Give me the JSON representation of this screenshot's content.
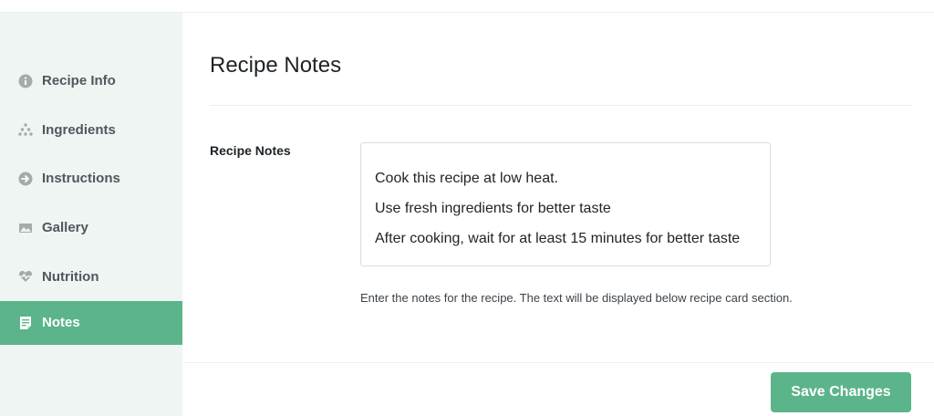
{
  "sidebar": {
    "items": [
      {
        "label": "Recipe Info",
        "icon": "info-icon",
        "active": false
      },
      {
        "label": "Ingredients",
        "icon": "ingredients-icon",
        "active": false
      },
      {
        "label": "Instructions",
        "icon": "arrow-right-circle-icon",
        "active": false
      },
      {
        "label": "Gallery",
        "icon": "gallery-icon",
        "active": false
      },
      {
        "label": "Nutrition",
        "icon": "heart-pulse-icon",
        "active": false
      },
      {
        "label": "Notes",
        "icon": "notes-icon",
        "active": true
      }
    ]
  },
  "main": {
    "title": "Recipe Notes",
    "field_label": "Recipe Notes",
    "notes_lines": [
      "Cook this recipe at low heat.",
      "Use fresh ingredients for better taste",
      "After cooking, wait for at least 15 minutes for better taste"
    ],
    "help_text": "Enter the notes for the recipe. The text will be displayed below recipe card section."
  },
  "footer": {
    "save_label": "Save Changes"
  },
  "colors": {
    "accent": "#5cb48b",
    "sidebar_bg": "#eef5f2",
    "icon_gray": "#a7aaad"
  }
}
